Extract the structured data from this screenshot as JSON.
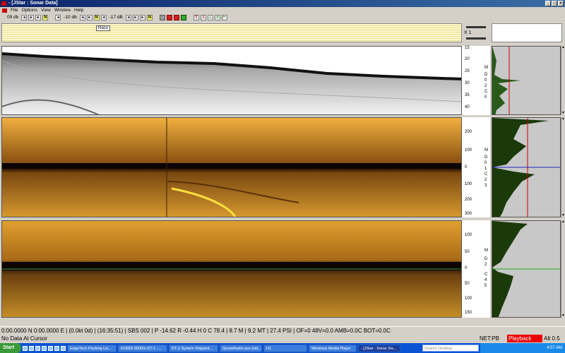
{
  "window": {
    "title": "- [JStar : Sonar Data]",
    "controls": [
      "_",
      "□",
      "×"
    ]
  },
  "menu": {
    "items": [
      "File",
      "Options",
      "View",
      "Window",
      "Help"
    ]
  },
  "toolbar": {
    "gain1": "09 db",
    "gain2": "-10 db",
    "gain3": "-17 dB",
    "n_label": "N",
    "t_label": "T"
  },
  "stripe": {
    "marker_label": "Raco",
    "zoom_label": "X 1"
  },
  "bathy": {
    "ticks": [
      "15",
      "20",
      "25",
      "30",
      "35",
      "40"
    ],
    "axis_letters": [
      "M",
      "D",
      "0",
      "2",
      "C",
      "0"
    ]
  },
  "sss1": {
    "ticks": [
      "200",
      "100",
      "0",
      "100",
      "200",
      "300"
    ],
    "axis_letters": [
      "M",
      "D",
      "0",
      "1",
      "C",
      "2",
      "3"
    ]
  },
  "sss2": {
    "ticks": [
      "100",
      "50",
      "0",
      "50",
      "100",
      "150"
    ],
    "axis_letters": [
      "M",
      "D",
      "2",
      "C",
      "4",
      "5"
    ]
  },
  "status": {
    "line1": "0:00.0000 N 0:00.0000 E | (0.0kt 0d) | (16:35:51) | SBS 002 | P -14.62 R -0.44 H 0 C 78.4 | 8.7 M | 9.2 MT | 27.4 PSI | OF=0 48V=0.0 AMB=0.0C BOT=0.0C",
    "line2": "No Data At Cursor",
    "net": "NET:PB",
    "playback": "Playback",
    "alt": "Alt 0.5"
  },
  "taskbar": {
    "start": "Start",
    "tasks": [
      "EdgeTech Packing Lis...",
      "KORDI 6000m DT-1 -...",
      "DT-2 System Shipped...",
      "QuranRadio.asx (vid...",
      "H1",
      "Windows Media Player",
      "- [JStar : Sonar Da..."
    ],
    "search_placeholder": "Search Desktop",
    "clock": "4:07 AM"
  },
  "colors": {
    "sonar_dark": "#3a1a00",
    "sonar_mid": "#b87410",
    "sonar_light": "#e0a030",
    "playback": "#e00000"
  }
}
